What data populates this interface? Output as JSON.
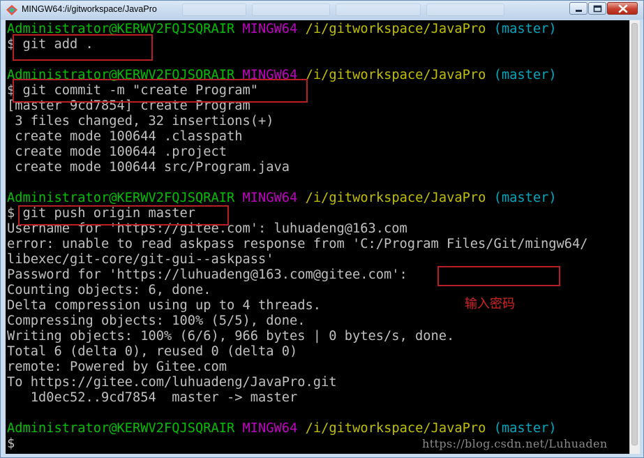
{
  "window": {
    "title": "MINGW64:/i/gitworkspace/JavaPro"
  },
  "prompt": {
    "user_host": "Administrator@KERWV2FQJSQRAIR",
    "system": "MINGW64",
    "path": "/i/gitworkspace/JavaPro",
    "branch": "(master)"
  },
  "terminal": {
    "lines": [
      {
        "text": "$ git add ."
      },
      {
        "text": ""
      },
      {
        "text": "$ git commit -m \"create Program\""
      },
      {
        "text": "[master 9cd7854] create Program"
      },
      {
        "text": " 3 files changed, 32 insertions(+)"
      },
      {
        "text": " create mode 100644 .classpath"
      },
      {
        "text": " create mode 100644 .project"
      },
      {
        "text": " create mode 100644 src/Program.java"
      },
      {
        "text": ""
      },
      {
        "text": "$ git push origin master"
      },
      {
        "text": "Username for 'https://gitee.com': luhuadeng@163.com"
      },
      {
        "text": "error: unable to read askpass response from 'C:/Program Files/Git/mingw64/"
      },
      {
        "text": "libexec/git-core/git-gui--askpass'"
      },
      {
        "text": "Password for 'https://luhuadeng@163.com@gitee.com':"
      },
      {
        "text": "Counting objects: 6, done."
      },
      {
        "text": "Delta compression using up to 4 threads."
      },
      {
        "text": "Compressing objects: 100% (5/5), done."
      },
      {
        "text": "Writing objects: 100% (6/6), 966 bytes | 0 bytes/s, done."
      },
      {
        "text": "Total 6 (delta 0), reused 0 (delta 0)"
      },
      {
        "text": "remote: Powered by Gitee.com"
      },
      {
        "text": "To https://gitee.com/luhuadeng/JavaPro.git"
      },
      {
        "text": "   1d0ec52..9cd7854  master -> master"
      },
      {
        "text": ""
      },
      {
        "text": "$"
      }
    ]
  },
  "annotation": {
    "label": "输入密码",
    "color": "#b62024"
  },
  "watermark": "https://blog.csdn.net/Luhuaden",
  "colors": {
    "prompt_user": "#00c000",
    "prompt_system": "#c000c0",
    "prompt_path": "#c0c000",
    "prompt_branch": "#00a8c0",
    "output": "#c0c0c0"
  }
}
